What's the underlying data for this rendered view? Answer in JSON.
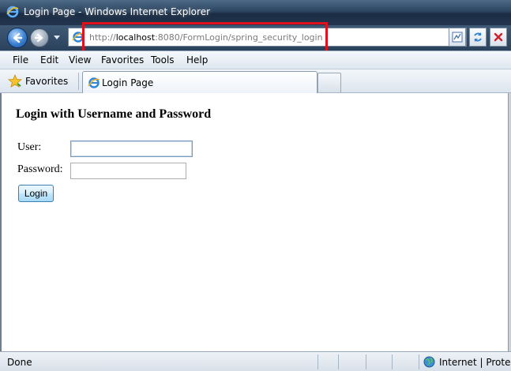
{
  "window": {
    "title": "Login Page - Windows Internet Explorer"
  },
  "address_bar": {
    "url_prefix": "http://",
    "url_host": "localhost",
    "url_rest": ":8080/FormLogin/spring_security_login"
  },
  "menu": {
    "items": [
      "File",
      "Edit",
      "View",
      "Favorites",
      "Tools",
      "Help"
    ]
  },
  "favorites_bar": {
    "favorites_label": "Favorites",
    "active_tab_label": "Login Page"
  },
  "page": {
    "heading": "Login with Username and Password",
    "user_label": "User:",
    "password_label": "Password:",
    "user_value": "",
    "password_value": "",
    "login_button_label": "Login"
  },
  "status": {
    "text": "Done",
    "zone": "Internet | Protecte"
  },
  "colors": {
    "highlight": "#e0101c"
  }
}
